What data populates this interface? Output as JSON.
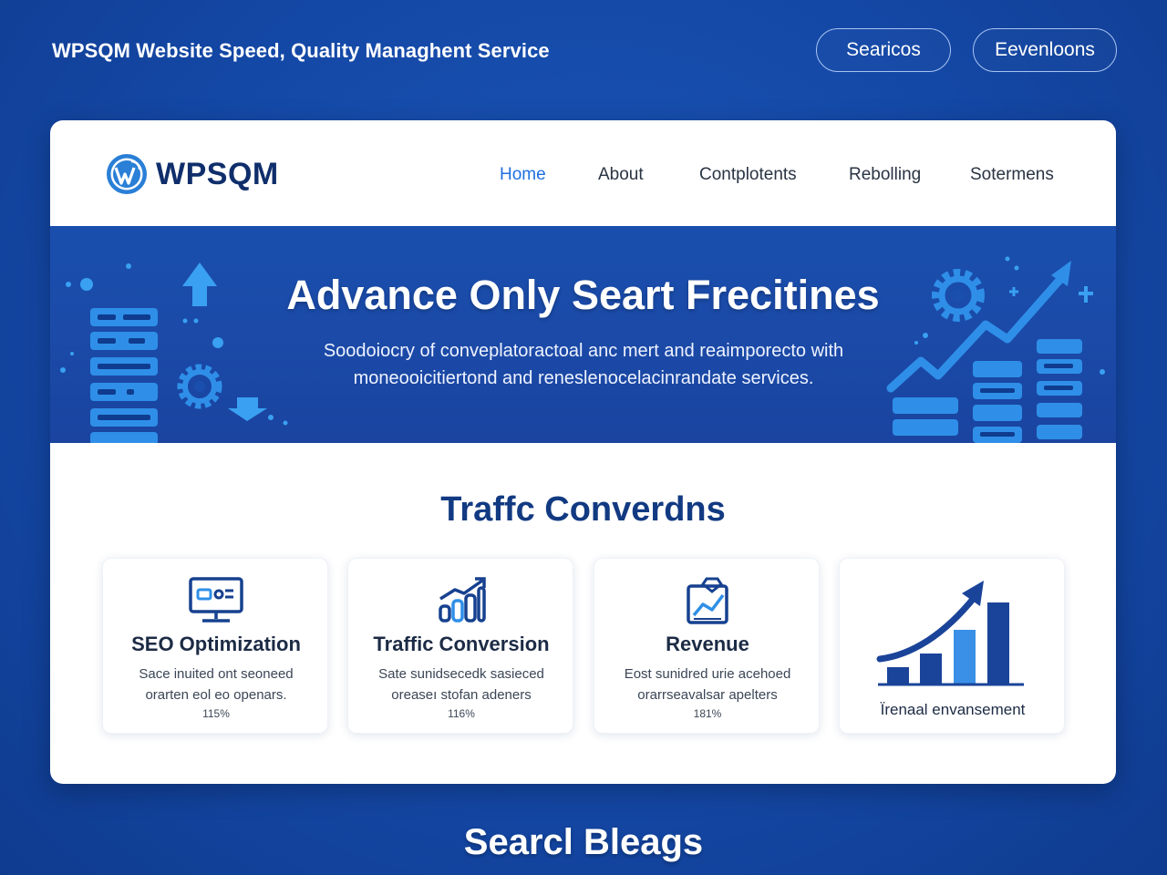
{
  "top": {
    "title": "WPSQM Website Speed, Quality Managhent Service",
    "buttons": [
      "Searicos",
      "Eevenloons"
    ]
  },
  "nav": {
    "logo": "WPSQM",
    "items": [
      {
        "label": "Home",
        "active": true
      },
      {
        "label": "About",
        "active": false
      },
      {
        "label": "Contplotents",
        "active": false
      },
      {
        "label": "Rebolling",
        "active": false
      },
      {
        "label": "Sotermens",
        "active": false
      }
    ]
  },
  "hero": {
    "title": "Advance Only Seart Frecitines",
    "subtitle": "Soodoiocry of conveplatoractoal anc mert and reaimporecto with moneooicitiertond and reneslenocelacinrandate services."
  },
  "section": {
    "title": "Traffc Converdns",
    "features": [
      {
        "icon": "seo-monitor-icon",
        "title": "SEO Optimization",
        "desc": "Sace inuited ont seoneed orarten eol eo openars.",
        "stat": "115%"
      },
      {
        "icon": "bar-growth-icon",
        "title": "Traffic Conversion",
        "desc": "Sate sunidsecedk sasieced oreaseı stofan adeners",
        "stat": "116%"
      },
      {
        "icon": "revenue-chart-icon",
        "title": "Revenue",
        "desc": "Eost sunidred urie acehoed orarrseavalsar apelters",
        "stat": "181%"
      },
      {
        "icon": "growth-chart-icon",
        "caption": "Ïrenaal envansement"
      }
    ]
  },
  "bottom": {
    "title": "Searcl Bleags"
  },
  "colors": {
    "background": "#1448a6",
    "hero": "#1a4fae",
    "accent": "#1f6fe0",
    "heading": "#123a82"
  }
}
